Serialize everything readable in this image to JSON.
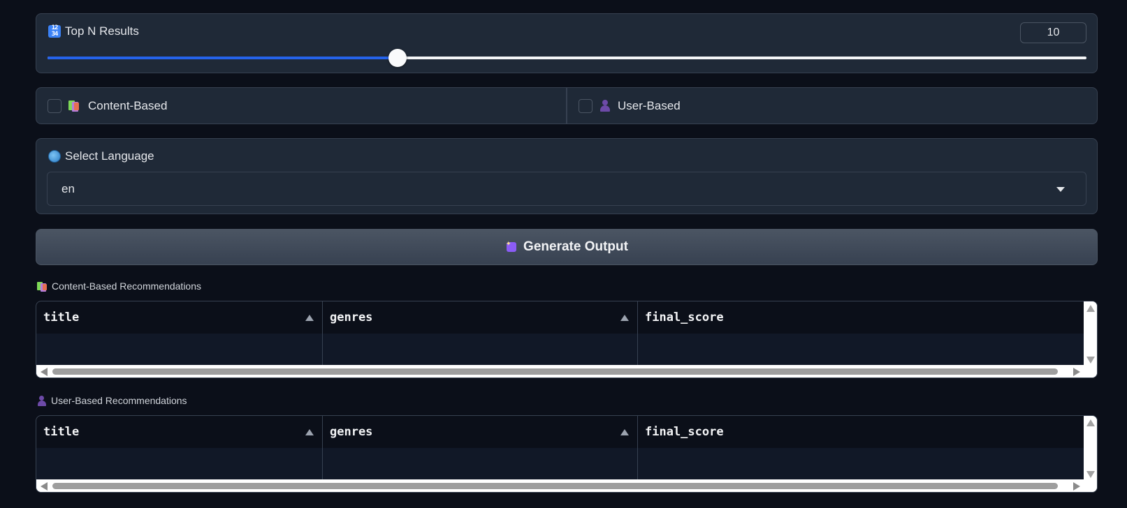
{
  "slider": {
    "label": "Top N Results",
    "label_icon": "input-numbers-icon",
    "value": "10",
    "fraction": 0.337,
    "accent": "#2563eb"
  },
  "recommenders": {
    "content_based": {
      "label": "Content-Based",
      "icon": "books-icon",
      "checked": false
    },
    "user_based": {
      "label": "User-Based",
      "icon": "bust-silhouette-icon",
      "checked": false
    }
  },
  "language": {
    "label": "Select Language",
    "icon": "globe-icon",
    "selected": "en"
  },
  "generate_button": {
    "label": "Generate Output",
    "icon": "mage-icon"
  },
  "content_results": {
    "label": "Content-Based Recommendations",
    "columns": [
      "title",
      "genres",
      "final_score"
    ],
    "rows": []
  },
  "user_results": {
    "label": "User-Based Recommendations",
    "columns": [
      "title",
      "genres",
      "final_score"
    ],
    "rows": []
  }
}
